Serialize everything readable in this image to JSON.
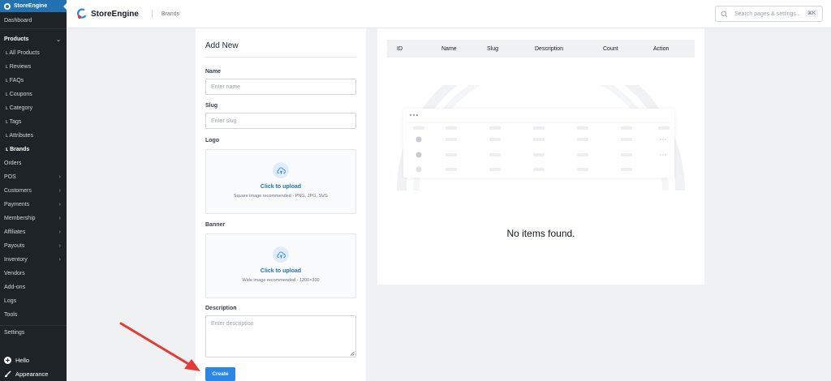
{
  "sidebar": {
    "app_title": "StoreEngine",
    "dashboard": "Dashboard",
    "products_section": "Products",
    "product_sub_items": [
      {
        "label": "ʟ All Products"
      },
      {
        "label": "ʟ Reviews"
      },
      {
        "label": "ʟ FAQs"
      },
      {
        "label": "ʟ Coupons"
      },
      {
        "label": "ʟ Category"
      },
      {
        "label": "ʟ Tags"
      },
      {
        "label": "ʟ Attributes"
      },
      {
        "label": "ʟ Brands"
      }
    ],
    "items": [
      {
        "label": "Orders"
      },
      {
        "label": "POS"
      },
      {
        "label": "Customers"
      },
      {
        "label": "Payments"
      },
      {
        "label": "Membership"
      },
      {
        "label": "Affiliates"
      },
      {
        "label": "Payouts"
      },
      {
        "label": "Inventory"
      },
      {
        "label": "Vendors"
      },
      {
        "label": "Add-ons"
      },
      {
        "label": "Logs"
      },
      {
        "label": "Tools"
      }
    ],
    "settings": "Settings",
    "hello": "Hello",
    "appearance": "Appearance"
  },
  "topbar": {
    "brand_name": "StoreEngine",
    "breadcrumb": "Brands",
    "search_placeholder": "Search pages & settings...",
    "search_shortcut": "⌘K"
  },
  "form": {
    "title": "Add New",
    "name_label": "Name",
    "name_placeholder": "Enter name",
    "slug_label": "Slug",
    "slug_placeholder": "Enter slug",
    "logo_label": "Logo",
    "logo_cta": "Click to upload",
    "logo_hint": "Square image recommended - PNG, JPG, SVG",
    "banner_label": "Banner",
    "banner_cta": "Click to upload",
    "banner_hint": "Wide image recommended - 1200×300",
    "description_label": "Description",
    "description_placeholder": "Enter description",
    "create_label": "Create"
  },
  "table": {
    "columns": [
      "ID",
      "Name",
      "Slug",
      "Description",
      "Count",
      "Action"
    ],
    "empty_message": "No items found."
  },
  "colors": {
    "accent": "#2271b1",
    "create_button": "#2b86e8",
    "sidebar_bg": "#1d2327",
    "arrow": "#e53935"
  }
}
